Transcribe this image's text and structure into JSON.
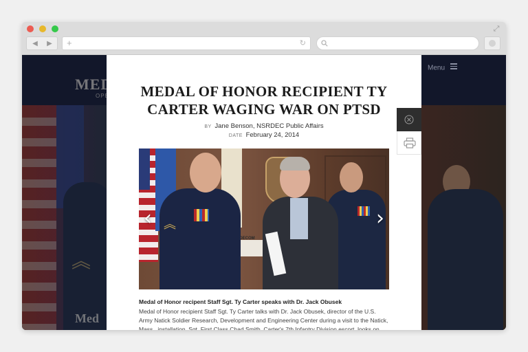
{
  "browser": {
    "back_glyph": "◀",
    "forward_glyph": "▶",
    "new_tab_glyph": "+",
    "reload_glyph": "↻",
    "expand_glyph": "⤢"
  },
  "site": {
    "logo_text": "MED",
    "logo_sub": "OPE",
    "menu_label": "Menu",
    "bg_text": "Med"
  },
  "article": {
    "title": "MEDAL OF HONOR RECIPIENT TY CARTER WAGING WAR ON PTSD",
    "by_label": "BY",
    "author": "Jane Benson, NSRDEC Public Affairs",
    "date_label": "DATE",
    "date": "February 24, 2014",
    "photo_sign_text": "RDECOM",
    "prev_arrow": "‹",
    "next_arrow": "›",
    "caption_title": "Medal of Honor recipent Staff Sgt. Ty Carter speaks with Dr. Jack Obusek",
    "caption_body": "Medal of Honor recipient Staff Sgt. Ty Carter talks with Dr. Jack Obusek, director of the U.S. Army Natick Soldier Research, Development and Engineering Center during a visit to the Natick, Mass., installation. Sgt. First Class Chad Smith, Carter's 7th Infantry Division escort, looks on."
  },
  "colors": {
    "accent_dark": "#2e2e2e",
    "header_navy": "#12172a"
  }
}
